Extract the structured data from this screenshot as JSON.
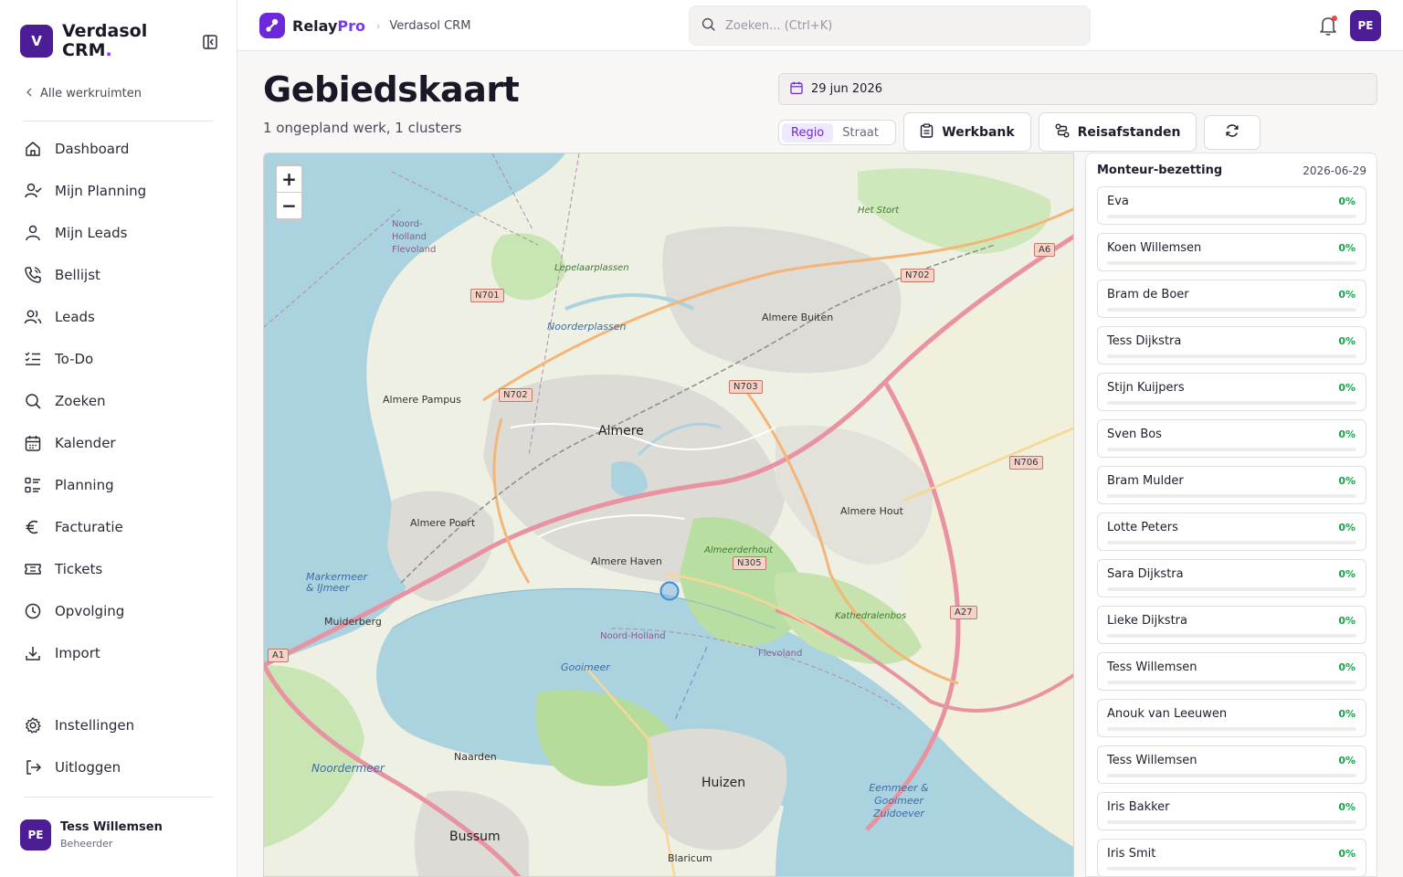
{
  "sidebar": {
    "brand_badge": "V",
    "brand_name": "Verdasol CRM",
    "brand_dot": ".",
    "back_label": "Alle werkruimten",
    "nav": [
      {
        "label": "Dashboard",
        "icon": "home-icon"
      },
      {
        "label": "Mijn Planning",
        "icon": "user-check-icon"
      },
      {
        "label": "Mijn Leads",
        "icon": "user-icon"
      },
      {
        "label": "Bellijst",
        "icon": "phone-icon"
      },
      {
        "label": "Leads",
        "icon": "users-icon"
      },
      {
        "label": "To-Do",
        "icon": "list-check-icon"
      },
      {
        "label": "Zoeken",
        "icon": "search-icon"
      },
      {
        "label": "Kalender",
        "icon": "calendar-icon"
      },
      {
        "label": "Planning",
        "icon": "list-icon"
      },
      {
        "label": "Facturatie",
        "icon": "euro-icon"
      },
      {
        "label": "Tickets",
        "icon": "ticket-icon"
      },
      {
        "label": "Opvolging",
        "icon": "clock-icon"
      },
      {
        "label": "Import",
        "icon": "download-icon"
      }
    ],
    "bottom": [
      {
        "label": "Instellingen",
        "icon": "gear-icon"
      },
      {
        "label": "Uitloggen",
        "icon": "logout-icon"
      }
    ],
    "user": {
      "initials": "PE",
      "name": "Tess Willemsen",
      "role": "Beheerder"
    }
  },
  "topbar": {
    "logo_main": "Relay",
    "logo_pro": "Pro",
    "crumb_sep": "›",
    "crumb": "Verdasol CRM",
    "search_placeholder": "Zoeken... (Ctrl+K)",
    "avatar": "PE"
  },
  "header": {
    "title": "Gebiedskaart",
    "subtitle": "1 ongepland werk, 1 clusters",
    "date": "29 jun 2026",
    "view_options": [
      "Regio",
      "Straat"
    ],
    "active_view": "Regio",
    "workbench_label": "Werkbank",
    "distances_label": "Reisafstanden"
  },
  "map": {
    "zoom_in": "+",
    "zoom_out": "−",
    "labels": {
      "almere": "Almere",
      "almere_buiten": "Almere Buiten",
      "almere_pampus": "Almere Pampus",
      "almere_poort": "Almere Poort",
      "almere_haven": "Almere Haven",
      "almere_hout": "Almere Hout",
      "muiderberg": "Muiderberg",
      "naarden": "Naarden",
      "huizen": "Huizen",
      "bussum": "Bussum",
      "blaricum": "Blaricum",
      "het_stort": "Het Stort",
      "lepelaarplassen": "Lepelaarplassen",
      "noorderplassen": "Noorderplassen",
      "almeerderhout": "Almeerderhout",
      "kathedralenbos": "Kathedralenbos",
      "markermeer": "Markermeer & IJmeer",
      "gooimeer": "Gooimeer",
      "noordermeer": "Noordermeer",
      "eemmeer": "Eemmeer & Gooimeer Zuidoever",
      "nh_flevoland": "Noord-Holland Flevoland",
      "noord_holland": "Noord-Holland",
      "flevoland": "Flevoland"
    },
    "roads": {
      "n701": "N701",
      "n702a": "N702",
      "n702b": "N702",
      "n703": "N703",
      "n706": "N706",
      "n305": "N305",
      "a6": "A6",
      "a27": "A27",
      "a1": "A1"
    },
    "marker_color": "#3b8fd6"
  },
  "panel": {
    "title": "Monteur-bezetting",
    "date": "2026-06-29",
    "technicians": [
      {
        "name": "Eva",
        "pct": "0%",
        "load": 0
      },
      {
        "name": "Koen Willemsen",
        "pct": "0%",
        "load": 0
      },
      {
        "name": "Bram de Boer",
        "pct": "0%",
        "load": 0
      },
      {
        "name": "Tess Dijkstra",
        "pct": "0%",
        "load": 0
      },
      {
        "name": "Stijn Kuijpers",
        "pct": "0%",
        "load": 0
      },
      {
        "name": "Sven Bos",
        "pct": "0%",
        "load": 0
      },
      {
        "name": "Bram Mulder",
        "pct": "0%",
        "load": 0
      },
      {
        "name": "Lotte Peters",
        "pct": "0%",
        "load": 0
      },
      {
        "name": "Sara Dijkstra",
        "pct": "0%",
        "load": 0
      },
      {
        "name": "Lieke Dijkstra",
        "pct": "0%",
        "load": 0
      },
      {
        "name": "Tess Willemsen",
        "pct": "0%",
        "load": 0
      },
      {
        "name": "Anouk van Leeuwen",
        "pct": "0%",
        "load": 0
      },
      {
        "name": "Tess Willemsen",
        "pct": "0%",
        "load": 0
      },
      {
        "name": "Iris Bakker",
        "pct": "0%",
        "load": 0
      },
      {
        "name": "Iris Smit",
        "pct": "0%",
        "load": 0
      }
    ]
  },
  "colors": {
    "brand": "#4c1d95",
    "accent": "#7c3aed",
    "success": "#16a34a"
  }
}
